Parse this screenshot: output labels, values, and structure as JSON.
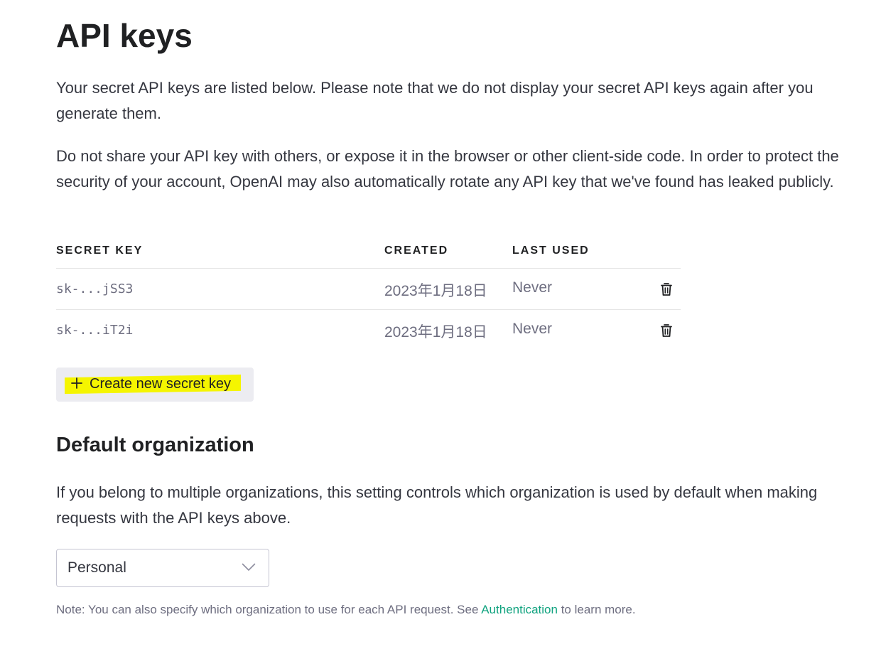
{
  "page": {
    "title": "API keys",
    "intro": "Your secret API keys are listed below. Please note that we do not display your secret API keys again after you generate them.",
    "warning": "Do not share your API key with others, or expose it in the browser or other client-side code. In order to protect the security of your account, OpenAI may also automatically rotate any API key that we've found has leaked publicly."
  },
  "table": {
    "headers": {
      "secret_key": "SECRET KEY",
      "created": "CREATED",
      "last_used": "LAST USED"
    },
    "rows": [
      {
        "key": "sk-...jSS3",
        "created": "2023年1月18日",
        "last_used": "Never",
        "action_icon": "trash-icon"
      },
      {
        "key": "sk-...iT2i",
        "created": "2023年1月18日",
        "last_used": "Never",
        "action_icon": "trash-icon"
      }
    ]
  },
  "create_button": {
    "label": "Create new secret key",
    "icon": "plus-icon",
    "highlight_color": "#f5f500"
  },
  "default_org": {
    "heading": "Default organization",
    "description": "If you belong to multiple organizations, this setting controls which organization is used by default when making requests with the API keys above.",
    "selected": "Personal",
    "note_prefix": "Note: You can also specify which organization to use for each API request. See ",
    "note_link": "Authentication",
    "note_suffix": " to learn more."
  },
  "colors": {
    "accent_link": "#10a37f",
    "button_bg": "#ececf1",
    "text_primary": "#202123",
    "text_secondary": "#6e6e80"
  }
}
